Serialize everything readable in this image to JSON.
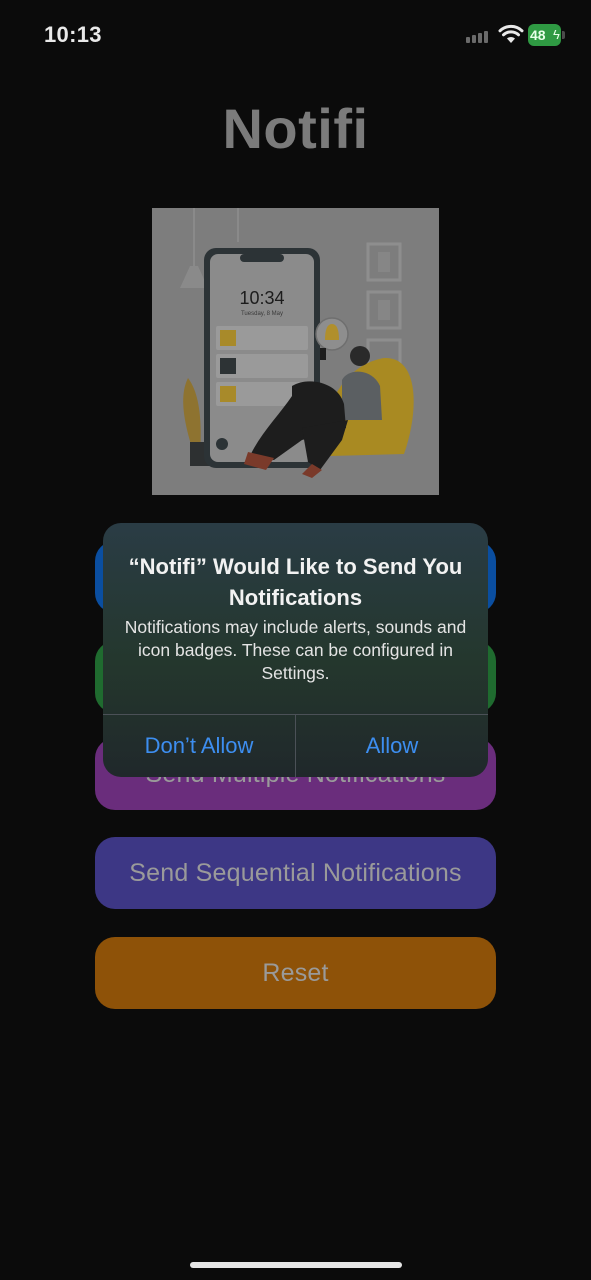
{
  "status_bar": {
    "time": "10:13",
    "battery_level": "48",
    "battery_color": "#2f9a43",
    "icons": [
      "cellular-signal-icon",
      "wifi-icon",
      "battery-charging-icon"
    ]
  },
  "app": {
    "title": "Notifi",
    "illustration": {
      "phone_time": "10:34",
      "phone_date": "Tuesday, 8 May"
    }
  },
  "buttons": [
    {
      "label": "",
      "color": "#0a4ea0"
    },
    {
      "label": "",
      "color": "#1f6b2f"
    },
    {
      "label": "Send Multiple Notifications",
      "color": "#6a2d7c"
    },
    {
      "label": "Send Sequential Notifications",
      "color": "#3d3785"
    },
    {
      "label": "Reset",
      "color": "#8e5208"
    }
  ],
  "alert": {
    "title": "“Notifi” Would Like to Send You Notifications",
    "message": "Notifications may include alerts, sounds and icon badges. These can be configured in Settings.",
    "deny_label": "Don’t Allow",
    "allow_label": "Allow",
    "button_color": "#3d8ef0"
  }
}
